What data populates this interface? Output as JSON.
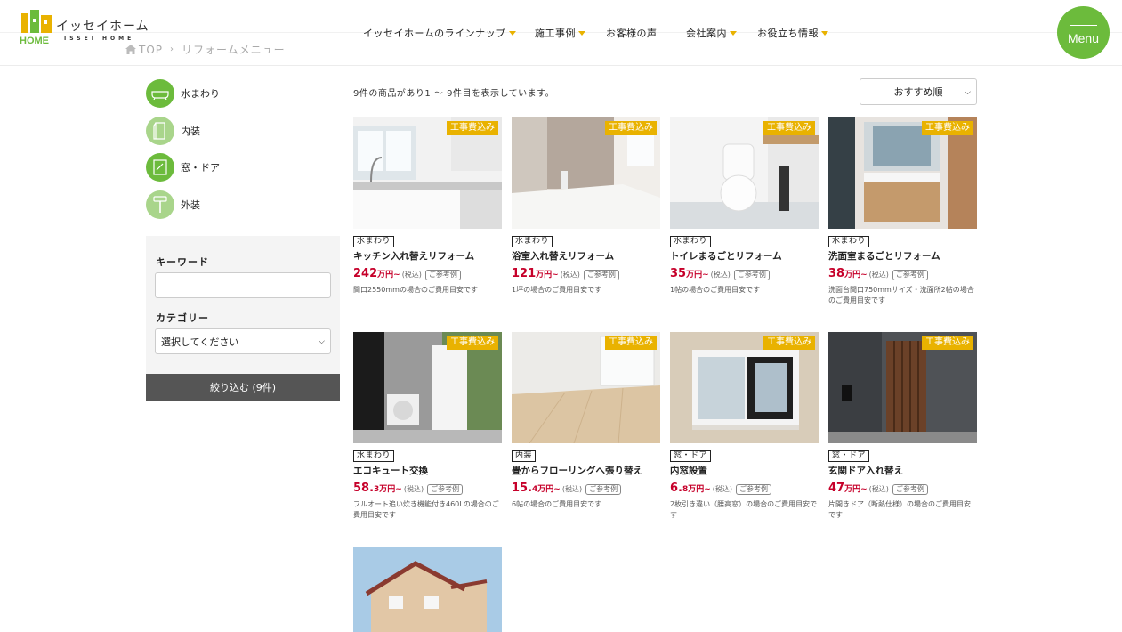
{
  "header": {
    "logo_ja": "イッセイホーム",
    "logo_en": "ISSEI HOME",
    "nav": [
      {
        "label": "イッセイホームのラインナップ",
        "dropdown": true
      },
      {
        "label": "施工事例",
        "dropdown": true
      },
      {
        "label": "お客様の声",
        "dropdown": false
      },
      {
        "label": "会社案内",
        "dropdown": true
      },
      {
        "label": "お役立ち情報",
        "dropdown": true
      }
    ],
    "menu_label": "Menu"
  },
  "breadcrumb": {
    "home": "TOP",
    "current": "リフォームメニュー"
  },
  "sidebar": {
    "categories": [
      {
        "label": "水まわり",
        "icon": "bathtub-icon"
      },
      {
        "label": "内装",
        "icon": "interior-wall-icon"
      },
      {
        "label": "窓・ドア",
        "icon": "window-door-icon"
      },
      {
        "label": "外装",
        "icon": "paint-roller-icon"
      }
    ],
    "filter": {
      "keyword_label": "キーワード",
      "keyword_value": "",
      "category_label": "カテゴリー",
      "category_selected": "選択してください",
      "submit_label": "絞り込む (9件)"
    }
  },
  "results": {
    "count_text": "9件の商品があり1 ～ 9件目を表示しています。",
    "sort_selected": "おすすめ順"
  },
  "products": [
    {
      "badge": "工事費込み",
      "tag": "水まわり",
      "title": "キッチン入れ替えリフォーム",
      "price": "242",
      "unit": "万円~",
      "tax": "(税込)",
      "ref": "ご参考例",
      "note": "間口2550mmの場合のご費用目安です"
    },
    {
      "badge": "工事費込み",
      "tag": "水まわり",
      "title": "浴室入れ替えリフォーム",
      "price": "121",
      "unit": "万円~",
      "tax": "(税込)",
      "ref": "ご参考例",
      "note": "1坪の場合のご費用目安です"
    },
    {
      "badge": "工事費込み",
      "tag": "水まわり",
      "title": "トイレまるごとリフォーム",
      "price": "35",
      "unit": "万円~",
      "tax": "(税込)",
      "ref": "ご参考例",
      "note": "1帖の場合のご費用目安です"
    },
    {
      "badge": "工事費込み",
      "tag": "水まわり",
      "title": "洗面室まるごとリフォーム",
      "price": "38",
      "unit": "万円~",
      "tax": "(税込)",
      "ref": "ご参考例",
      "note": "洗面台間口750mmサイズ・洗面所2帖の場合のご費用目安です"
    },
    {
      "badge": "工事費込み",
      "tag": "水まわり",
      "title": "エコキュート交換",
      "price": "58.",
      "unit": "3万円~",
      "tax": "(税込)",
      "ref": "ご参考例",
      "note": "フルオート追い炊き機能付き460Lの場合のご費用目安です"
    },
    {
      "badge": "工事費込み",
      "tag": "内装",
      "title": "畳からフローリングへ張り替え",
      "price": "15.",
      "unit": "4万円~",
      "tax": "(税込)",
      "ref": "ご参考例",
      "note": "6帖の場合のご費用目安です"
    },
    {
      "badge": "工事費込み",
      "tag": "窓・ドア",
      "title": "内窓設置",
      "price": "6.",
      "unit": "8万円~",
      "tax": "(税込)",
      "ref": "ご参考例",
      "note": "2枚引き違い（腰高窓）の場合のご費用目安です"
    },
    {
      "badge": "工事費込み",
      "tag": "窓・ドア",
      "title": "玄関ドア入れ替え",
      "price": "47",
      "unit": "万円~",
      "tax": "(税込)",
      "ref": "ご参考例",
      "note": "片開きドア（断熱仕様）の場合のご費用目安です"
    },
    {
      "badge": "",
      "tag": "",
      "title": "",
      "price": "",
      "unit": "",
      "tax": "",
      "ref": "",
      "note": ""
    }
  ],
  "colors": {
    "brand_green": "#6cbb3c",
    "badge_yellow": "#e9b200",
    "price_red": "#c6002a",
    "button_gray": "#555555"
  }
}
